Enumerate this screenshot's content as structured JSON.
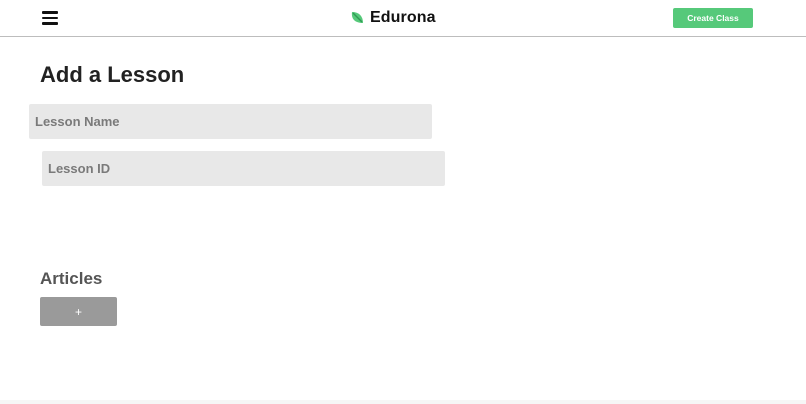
{
  "nav": {
    "menu_icon": "hamburger-menu-icon",
    "brand_icon": "leaf-icon",
    "brand_name": "Edurona",
    "create_class_label": "Create Class"
  },
  "form": {
    "title": "Add a Lesson",
    "lesson_name_placeholder": "Lesson Name",
    "lesson_id_placeholder": "Lesson ID"
  },
  "articles": {
    "heading": "Articles",
    "add_label": "+"
  },
  "colors": {
    "accent_green": "#56c97a",
    "input_bg": "#e8e8e8",
    "add_button_bg": "#9a9a9a"
  }
}
